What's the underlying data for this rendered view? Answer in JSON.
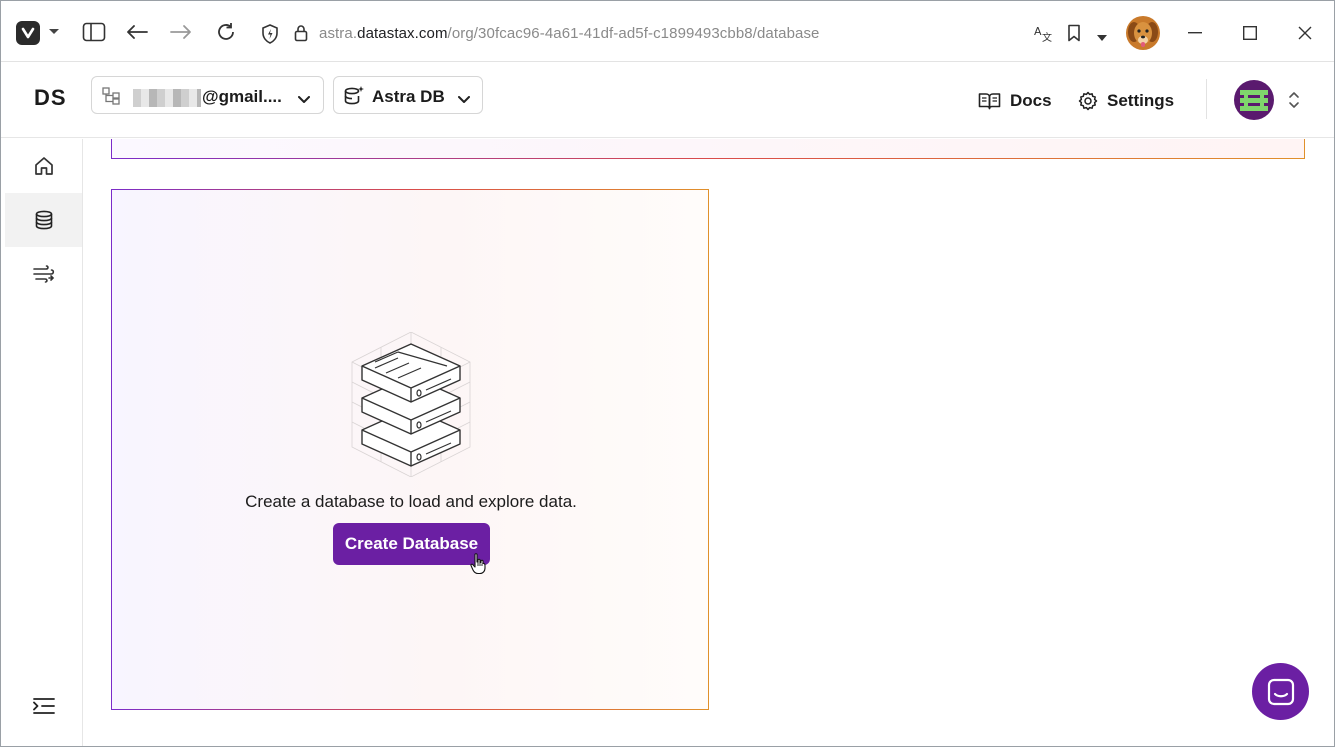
{
  "browser": {
    "url_prefix": "astra.",
    "url_host": "datastax.com",
    "url_path": "/org/30fcac96-4a61-41df-ad5f-c1899493cbb8/database"
  },
  "header": {
    "logo": "DS",
    "org_selector": "@gmail....",
    "db_selector": "Astra DB",
    "docs_label": "Docs",
    "settings_label": "Settings"
  },
  "sidebar": {
    "items": [
      "home-icon",
      "database-icon",
      "streaming-icon"
    ],
    "active": "database-icon",
    "collapse_icon": "collapse-menu-icon"
  },
  "empty_state": {
    "message": "Create a database to load and explore data.",
    "button_label": "Create Database"
  },
  "colors": {
    "brand_purple": "#6b1fa3",
    "gradient_start": "#7b2cc9",
    "gradient_mid": "#d94b4b",
    "gradient_end": "#e0902b"
  }
}
